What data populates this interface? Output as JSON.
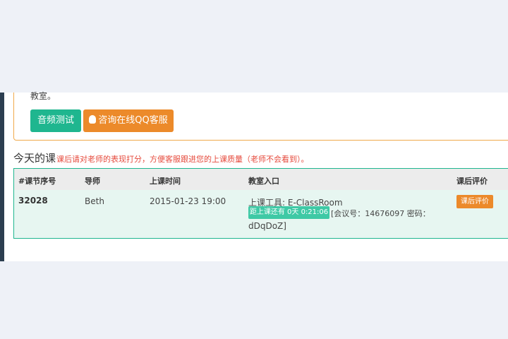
{
  "notice": {
    "text": "教室。"
  },
  "buttons": {
    "audio_test": "音频测试",
    "qq_support": "咨询在线QQ客服"
  },
  "section": {
    "title": "今天的课",
    "note": "课后请对老师的表现打分，方便客服跟进您的上课质量（老师不会看到）。"
  },
  "table": {
    "headers": [
      "#课节序号",
      "导师",
      "上课时间",
      "教室入口",
      "课后评价"
    ],
    "row": {
      "lesson_no": "32028",
      "tutor": "Beth",
      "time": "2015-01-23 19:00",
      "tool": "上课工具: E-ClassRoom",
      "countdown": "距上课还有 0天 0:21:06",
      "meeting_info": "[会议号：14676097 密码：",
      "password": "dDqDoZ]",
      "evaluate_button": "课后评价"
    }
  },
  "colors": {
    "green": "#1fb68f",
    "orange": "#ec8a2a",
    "red_text": "#e64a3c"
  }
}
